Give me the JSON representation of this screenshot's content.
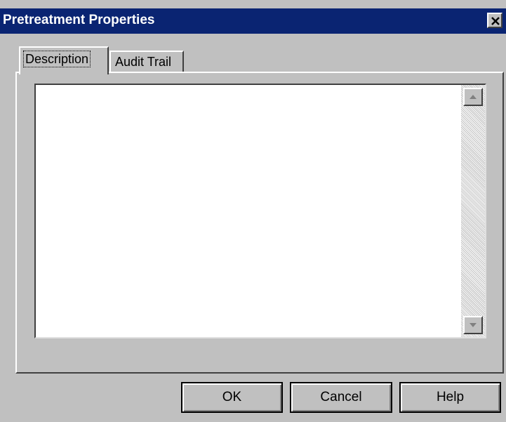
{
  "window": {
    "title": "Pretreatment Properties",
    "close_icon": "close-icon"
  },
  "tabs": [
    {
      "label": "Description",
      "active": true
    },
    {
      "label": "Audit Trail",
      "active": false
    }
  ],
  "description_field": {
    "value": "",
    "scroll_up_icon": "up-arrow-icon",
    "scroll_down_icon": "down-arrow-icon"
  },
  "buttons": {
    "ok": "OK",
    "cancel": "Cancel",
    "help": "Help"
  },
  "colors": {
    "title_bar": "#0a2472",
    "dialog_bg": "#c0c0c0"
  }
}
